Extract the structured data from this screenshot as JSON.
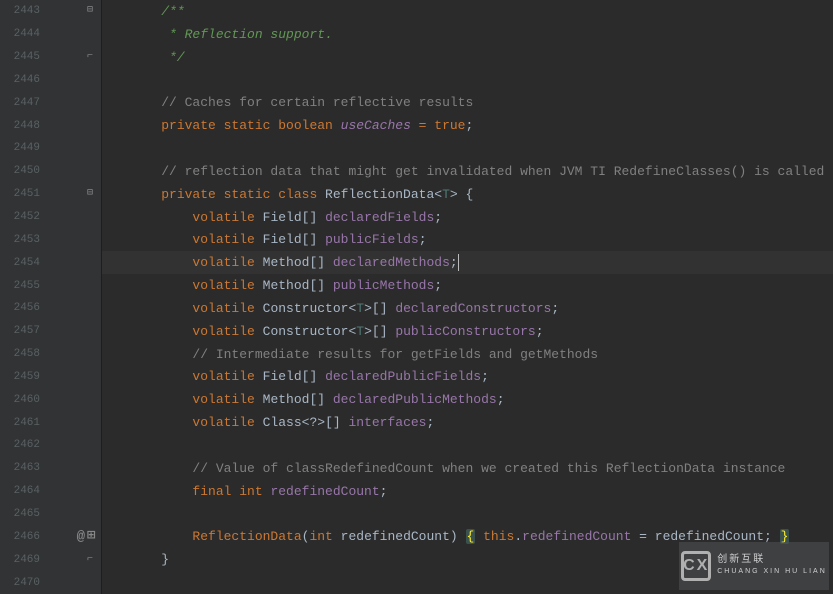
{
  "watermark": {
    "logo": "CX",
    "line1": "创新互联",
    "line2": "CHUANG XIN HU LIAN"
  },
  "lines": [
    {
      "no": "2443",
      "fold": "open",
      "tokens": [
        [
          "    ",
          ""
        ],
        [
          "/**",
          "doc"
        ]
      ]
    },
    {
      "no": "2444",
      "tokens": [
        [
          "     * Reflection support.",
          "doc"
        ]
      ]
    },
    {
      "no": "2445",
      "fold": "close",
      "tokens": [
        [
          "     */",
          "doc"
        ]
      ]
    },
    {
      "no": "2446",
      "tokens": []
    },
    {
      "no": "2447",
      "tokens": [
        [
          "    ",
          ""
        ],
        [
          "// Caches for certain reflective results",
          "com"
        ]
      ]
    },
    {
      "no": "2448",
      "tokens": [
        [
          "    ",
          ""
        ],
        [
          "private static boolean ",
          "kw"
        ],
        [
          "useCaches",
          "fieldi"
        ],
        [
          " = ",
          "kw"
        ],
        [
          "true",
          "bool"
        ],
        [
          ";",
          ""
        ]
      ]
    },
    {
      "no": "2449",
      "tokens": []
    },
    {
      "no": "2450",
      "tokens": [
        [
          "    ",
          ""
        ],
        [
          "// reflection data that might get invalidated when JVM TI RedefineClasses() is called",
          "com"
        ]
      ]
    },
    {
      "no": "2451",
      "fold": "open",
      "tokens": [
        [
          "    ",
          ""
        ],
        [
          "private static class ",
          "kw"
        ],
        [
          "ReflectionData",
          ""
        ],
        [
          "<",
          ""
        ],
        [
          "T",
          "type"
        ],
        [
          "> {",
          ""
        ]
      ]
    },
    {
      "no": "2452",
      "tokens": [
        [
          "        ",
          ""
        ],
        [
          "volatile ",
          "kw"
        ],
        [
          "Field[] ",
          ""
        ],
        [
          "declaredFields",
          "field"
        ],
        [
          ";",
          ""
        ]
      ]
    },
    {
      "no": "2453",
      "tokens": [
        [
          "        ",
          ""
        ],
        [
          "volatile ",
          "kw"
        ],
        [
          "Field[] ",
          ""
        ],
        [
          "publicFields",
          "field"
        ],
        [
          ";",
          ""
        ]
      ]
    },
    {
      "no": "2454",
      "current": true,
      "tokens": [
        [
          "        ",
          ""
        ],
        [
          "volatile ",
          "kw"
        ],
        [
          "Method[] ",
          ""
        ],
        [
          "declaredMethods",
          "field"
        ],
        [
          ";",
          ""
        ],
        [
          "CARET",
          ""
        ]
      ]
    },
    {
      "no": "2455",
      "tokens": [
        [
          "        ",
          ""
        ],
        [
          "volatile ",
          "kw"
        ],
        [
          "Method[] ",
          ""
        ],
        [
          "publicMethods",
          "field"
        ],
        [
          ";",
          ""
        ]
      ]
    },
    {
      "no": "2456",
      "tokens": [
        [
          "        ",
          ""
        ],
        [
          "volatile ",
          "kw"
        ],
        [
          "Constructor",
          ""
        ],
        [
          "<",
          ""
        ],
        [
          "T",
          "type"
        ],
        [
          ">",
          ""
        ],
        [
          "[] ",
          ""
        ],
        [
          "declaredConstructors",
          "field"
        ],
        [
          ";",
          ""
        ]
      ]
    },
    {
      "no": "2457",
      "tokens": [
        [
          "        ",
          ""
        ],
        [
          "volatile ",
          "kw"
        ],
        [
          "Constructor",
          ""
        ],
        [
          "<",
          ""
        ],
        [
          "T",
          "type"
        ],
        [
          ">",
          ""
        ],
        [
          "[] ",
          ""
        ],
        [
          "publicConstructors",
          "field"
        ],
        [
          ";",
          ""
        ]
      ]
    },
    {
      "no": "2458",
      "tokens": [
        [
          "        ",
          ""
        ],
        [
          "// Intermediate results for getFields and getMethods",
          "com"
        ]
      ]
    },
    {
      "no": "2459",
      "tokens": [
        [
          "        ",
          ""
        ],
        [
          "volatile ",
          "kw"
        ],
        [
          "Field[] ",
          ""
        ],
        [
          "declaredPublicFields",
          "field"
        ],
        [
          ";",
          ""
        ]
      ]
    },
    {
      "no": "2460",
      "tokens": [
        [
          "        ",
          ""
        ],
        [
          "volatile ",
          "kw"
        ],
        [
          "Method[] ",
          ""
        ],
        [
          "declaredPublicMethods",
          "field"
        ],
        [
          ";",
          ""
        ]
      ]
    },
    {
      "no": "2461",
      "tokens": [
        [
          "        ",
          ""
        ],
        [
          "volatile ",
          "kw"
        ],
        [
          "Class",
          ""
        ],
        [
          "<?>",
          ""
        ],
        [
          "[] ",
          ""
        ],
        [
          "interfaces",
          "field"
        ],
        [
          ";",
          ""
        ]
      ]
    },
    {
      "no": "2462",
      "tokens": []
    },
    {
      "no": "2463",
      "tokens": [
        [
          "        ",
          ""
        ],
        [
          "// Value of classRedefinedCount when we created this ReflectionData instance",
          "com"
        ]
      ]
    },
    {
      "no": "2464",
      "tokens": [
        [
          "        ",
          ""
        ],
        [
          "final int ",
          "kw"
        ],
        [
          "redefinedCount",
          "field"
        ],
        [
          ";",
          ""
        ]
      ]
    },
    {
      "no": "2465",
      "tokens": []
    },
    {
      "no": "2466",
      "at": true,
      "plus": true,
      "tokens": [
        [
          "        ",
          ""
        ],
        [
          "ReflectionData",
          "kw"
        ],
        [
          "(",
          ""
        ],
        [
          "int ",
          "kw"
        ],
        [
          "redefinedCount) ",
          ""
        ],
        [
          "{",
          "brace-hl"
        ],
        [
          " ",
          ""
        ],
        [
          "this",
          "kw"
        ],
        [
          ".",
          ""
        ],
        [
          "redefinedCount",
          "field"
        ],
        [
          " = redefinedCount; ",
          ""
        ],
        [
          "}",
          "brace-hl"
        ]
      ]
    },
    {
      "no": "2469",
      "fold": "close",
      "tokens": [
        [
          "    }",
          ""
        ]
      ]
    },
    {
      "no": "2470",
      "tokens": []
    }
  ]
}
